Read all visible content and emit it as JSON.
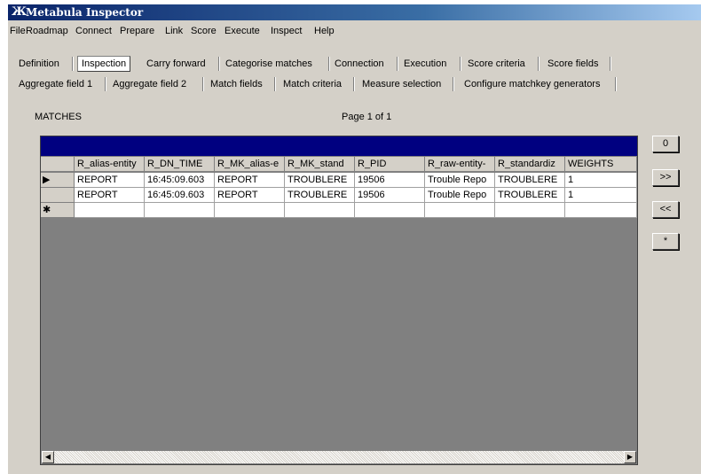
{
  "window": {
    "title": "Metabula Inspector",
    "icon": "app-x-icon"
  },
  "menu": [
    "File",
    "Roadmap",
    "Connect",
    "Prepare",
    "Link",
    "Score",
    "Execute",
    "Inspect",
    "Help"
  ],
  "tabs_row1": [
    "Definition",
    "Inspection",
    "Carry forward",
    "Categorise matches",
    "Connection",
    "Execution",
    "Score criteria",
    "Score fields"
  ],
  "tabs_row2": [
    "Aggregate field 1",
    "Aggregate field 2",
    "Match fields",
    "Match criteria",
    "Measure selection",
    "Configure matchkey generators"
  ],
  "active_tab": "Inspection",
  "section_label": "MATCHES",
  "page_label": "Page 1 of 1",
  "grid": {
    "columns": [
      "R_alias-entity",
      "R_DN_TIME",
      "R_MK_alias-e",
      "R_MK_stand",
      "R_PID",
      "R_raw-entity-",
      "R_standardiz",
      "WEIGHTS"
    ],
    "rows": [
      [
        "REPORT",
        "16:45:09.603",
        "REPORT",
        "TROUBLERE",
        "19506",
        "Trouble Repo",
        "TROUBLERE",
        "1"
      ],
      [
        "REPORT",
        "16:45:09.603",
        "REPORT",
        "TROUBLERE",
        "19506",
        "Trouble Repo",
        "TROUBLERE",
        "1"
      ]
    ],
    "current_row_marker": "▶",
    "new_row_marker": "✱"
  },
  "nav_buttons": {
    "zero": "0",
    "next": ">>",
    "prev": "<<",
    "star": "*"
  }
}
